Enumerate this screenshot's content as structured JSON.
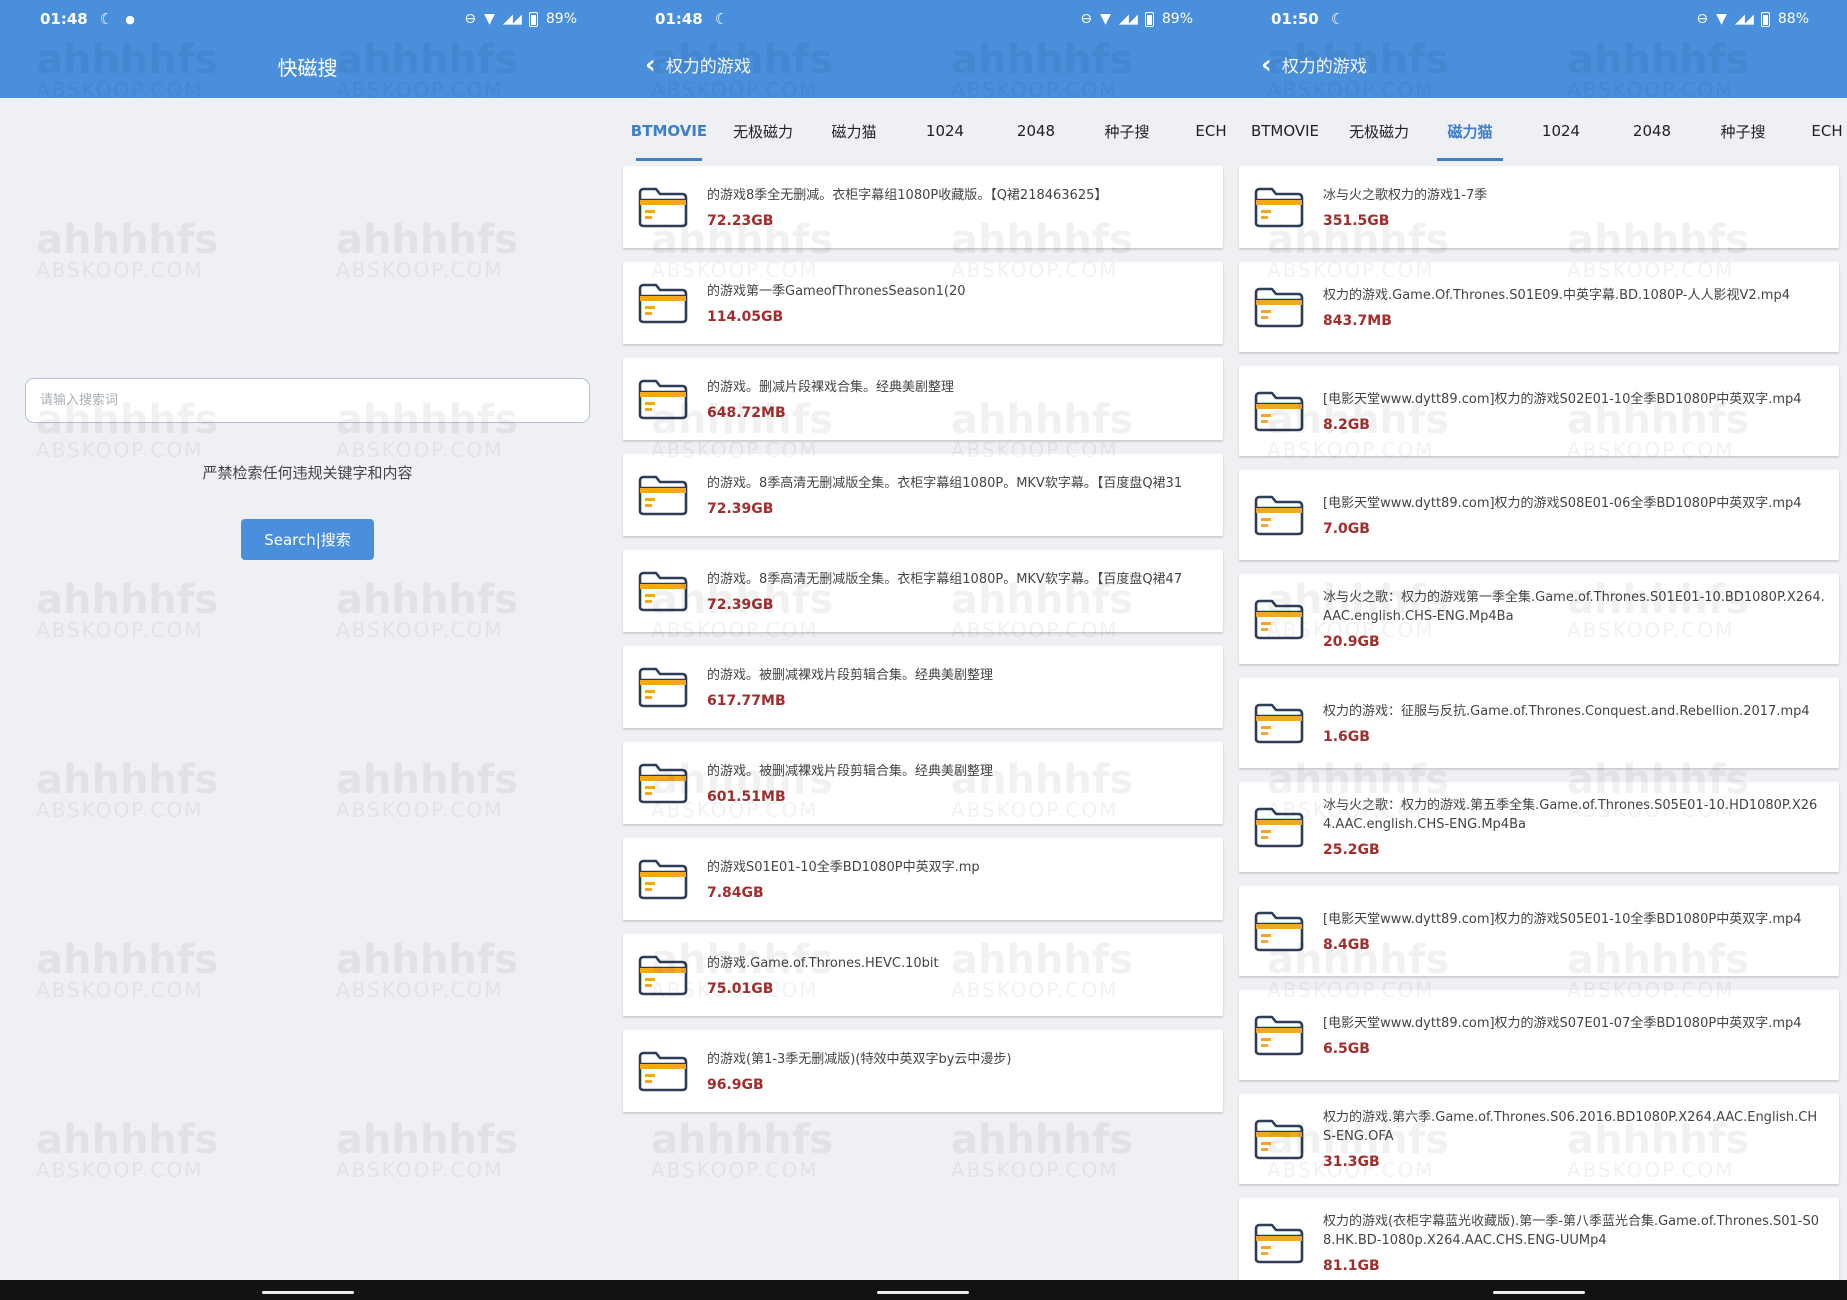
{
  "screens": [
    {
      "status": {
        "time": "01:48",
        "battery": "89%"
      },
      "header_title": "快磁搜",
      "search": {
        "placeholder": "请输入搜索词"
      },
      "warning": "严禁检索任何违规关键字和内容",
      "button_label": "Search|搜索"
    },
    {
      "status": {
        "time": "01:48",
        "battery": "89%"
      },
      "header_title": "权力的游戏",
      "tabs": [
        "BTMOVIE",
        "无极磁力",
        "磁力猫",
        "1024",
        "2048",
        "种子搜",
        "ECH"
      ],
      "active_tab": 0,
      "results": [
        {
          "name": "的游戏8季全无删减。衣柜字幕组1080P收藏版。【Q裙218463625】",
          "size": "72.23GB"
        },
        {
          "name": "的游戏第一季GameofThronesSeason1(20",
          "size": "114.05GB"
        },
        {
          "name": "的游戏。删减片段裸戏合集。经典美剧整理",
          "size": "648.72MB"
        },
        {
          "name": "的游戏。8季高清无删减版全集。衣柜字幕组1080P。MKV软字幕。【百度盘Q裙31",
          "size": "72.39GB"
        },
        {
          "name": "的游戏。8季高清无删减版全集。衣柜字幕组1080P。MKV软字幕。【百度盘Q裙47",
          "size": "72.39GB"
        },
        {
          "name": "的游戏。被删减裸戏片段剪辑合集。经典美剧整理",
          "size": "617.77MB"
        },
        {
          "name": "的游戏。被删减裸戏片段剪辑合集。经典美剧整理",
          "size": "601.51MB"
        },
        {
          "name": "的游戏S01E01-10全季BD1080P中英双字.mp",
          "size": "7.84GB"
        },
        {
          "name": "的游戏.Game.of.Thrones.HEVC.10bit",
          "size": "75.01GB"
        },
        {
          "name": "的游戏(第1-3季无删减版)(特效中英双字by云中漫步)",
          "size": "96.9GB"
        }
      ]
    },
    {
      "status": {
        "time": "01:50",
        "battery": "88%"
      },
      "header_title": "权力的游戏",
      "tabs": [
        "BTMOVIE",
        "无极磁力",
        "磁力猫",
        "1024",
        "2048",
        "种子搜",
        "ECH"
      ],
      "active_tab": 2,
      "results": [
        {
          "name": "冰与火之歌权力的游戏1-7季",
          "size": "351.5GB"
        },
        {
          "name": "权力的游戏.Game.Of.Thrones.S01E09.中英字幕.BD.1080P-人人影视V2.mp4",
          "size": "843.7MB"
        },
        {
          "name": "[电影天堂www.dytt89.com]权力的游戏S02E01-10全季BD1080P中英双字.mp4",
          "size": "8.2GB"
        },
        {
          "name": "[电影天堂www.dytt89.com]权力的游戏S08E01-06全季BD1080P中英双字.mp4",
          "size": "7.0GB"
        },
        {
          "name": "冰与火之歌：权力的游戏第一季全集.Game.of.Thrones.S01E01-10.BD1080P.X264.AAC.english.CHS-ENG.Mp4Ba",
          "size": "20.9GB"
        },
        {
          "name": "权力的游戏：征服与反抗.Game.of.Thrones.Conquest.and.Rebellion.2017.mp4",
          "size": "1.6GB"
        },
        {
          "name": "冰与火之歌：权力的游戏.第五季全集.Game.of.Thrones.S05E01-10.HD1080P.X264.AAC.english.CHS-ENG.Mp4Ba",
          "size": "25.2GB"
        },
        {
          "name": "[电影天堂www.dytt89.com]权力的游戏S05E01-10全季BD1080P中英双字.mp4",
          "size": "8.4GB"
        },
        {
          "name": "[电影天堂www.dytt89.com]权力的游戏S07E01-07全季BD1080P中英双字.mp4",
          "size": "6.5GB"
        },
        {
          "name": "权力的游戏.第六季.Game.of.Thrones.S06.2016.BD1080P.X264.AAC.English.CHS-ENG.OFA",
          "size": "31.3GB"
        },
        {
          "name": "权力的游戏(衣柜字幕蓝光收藏版).第一季-第八季蓝光合集.Game.of.Thrones.S01-S08.HK.BD-1080p.X264.AAC.CHS.ENG-UUMp4",
          "size": "81.1GB"
        }
      ]
    }
  ],
  "watermark": {
    "main": "ahhhhfs",
    "sub": "ABSKOOP.COM"
  },
  "colors": {
    "header": "#4a8fdc",
    "accent": "#3e7fcc",
    "size": "#a32d2d",
    "folder": "#f5a623"
  },
  "icons": {
    "folder": "folder-icon",
    "back": "chevron-left-icon",
    "moon": "moon-icon",
    "wifi": "wifi-icon",
    "signal": "signal-icon",
    "battery": "battery-icon"
  }
}
